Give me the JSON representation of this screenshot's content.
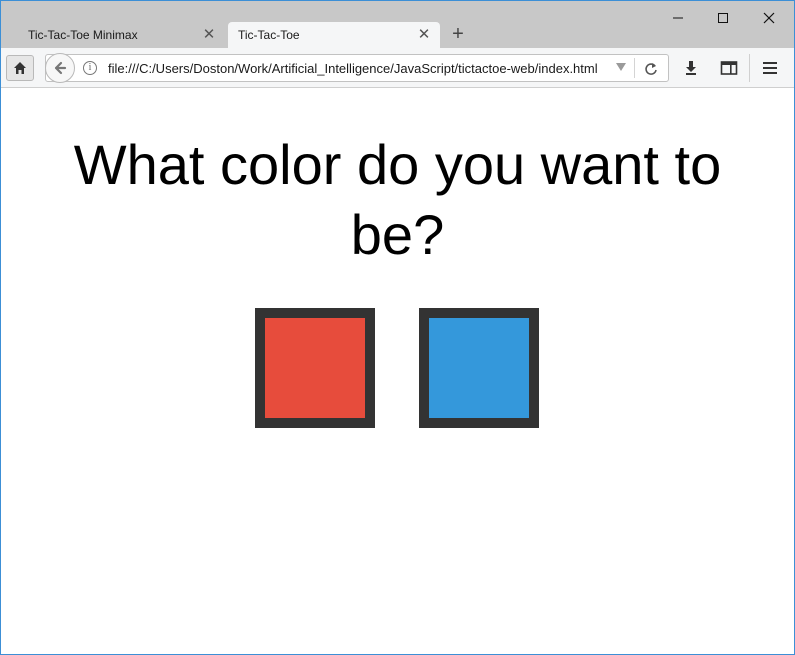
{
  "browser": {
    "tabs": [
      {
        "label": "Tic-Tac-Toe Minimax",
        "active": false
      },
      {
        "label": "Tic-Tac-Toe",
        "active": true
      }
    ],
    "new_tab_icon": "plus-icon",
    "window_controls": {
      "minimize": "minimize-icon",
      "maximize": "maximize-icon",
      "close": "close-icon"
    },
    "url": "file:///C:/Users/Doston/Work/Artificial_Intelligence/JavaScript/tictactoe-web/index.html",
    "icons": [
      "home-icon",
      "back-icon",
      "info-icon",
      "dropdown-icon",
      "reload-icon",
      "download-icon",
      "library-icon",
      "menu-icon"
    ]
  },
  "page": {
    "question": "What color do you want to be?",
    "color_options": [
      {
        "name": "red",
        "fill": "#e74c3c",
        "border": "#333333"
      },
      {
        "name": "blue",
        "fill": "#3498db",
        "border": "#333333"
      }
    ]
  }
}
